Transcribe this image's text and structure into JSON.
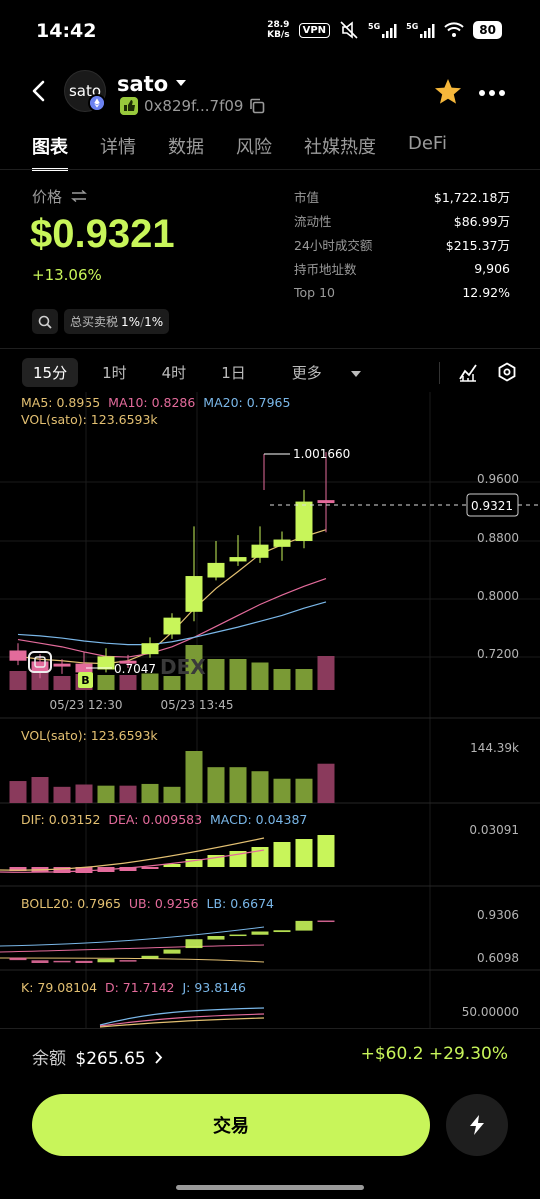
{
  "status": {
    "time": "14:42",
    "speed_top": "28.9",
    "speed_bottom": "KB/s",
    "vpn": "VPN",
    "net1": "5G",
    "net2": "5G",
    "battery": "80"
  },
  "header": {
    "avatar_text": "sato",
    "token": "sato",
    "address": "0x829f...7f09"
  },
  "tabs": [
    "图表",
    "详情",
    "数据",
    "风险",
    "社媒热度",
    "DeFi"
  ],
  "price": {
    "label": "价格",
    "value": "$0.9321",
    "change": "+13.06%",
    "tax_label": "总买卖税",
    "tax_buy": "1%",
    "tax_sep": "/",
    "tax_sell": "1%"
  },
  "stats": [
    {
      "k": "市值",
      "v": "$1,722.18万"
    },
    {
      "k": "流动性",
      "v": "$86.99万"
    },
    {
      "k": "24小时成交额",
      "v": "$215.37万"
    },
    {
      "k": "持币地址数",
      "v": "9,906"
    },
    {
      "k": "Top 10",
      "v": "12.92%"
    }
  ],
  "timeframes": [
    "15分",
    "1时",
    "4时",
    "1日",
    "更多"
  ],
  "indicators": {
    "ma5": "MA5: 0.8955",
    "ma10": "MA10: 0.8286",
    "ma20": "MA20: 0.7965",
    "vol": "VOL(sato): 123.6593k",
    "vol2": "VOL(sato): 123.6593k",
    "dif": "DIF: 0.03152",
    "dea": "DEA: 0.009583",
    "macd": "MACD: 0.04387",
    "boll": "BOLL20: 0.7965",
    "ub": "UB: 0.9256",
    "lb": "LB: 0.6674",
    "k": "K: 79.08104",
    "d": "D: 71.7142",
    "j": "J: 93.8146"
  },
  "chart_labels": {
    "high": "1.001660",
    "low": "0.7047",
    "current": "0.9321",
    "watermark": "DEX",
    "price_ticks": [
      "0.9600",
      "0.8800",
      "0.8000",
      "0.7200"
    ],
    "dates": [
      "05/23 12:30",
      "05/23 13:45"
    ],
    "vol_tick": "144.39k",
    "macd_tick": "0.03091",
    "boll_ticks": [
      "0.9306",
      "0.6098"
    ],
    "kdj_tick": "50.00000",
    "buy_marker": "B"
  },
  "footer": {
    "balance_label": "余额",
    "balance": "$265.65",
    "pnl": "+$60.2 +29.30%",
    "trade": "交易"
  },
  "colors": {
    "up": "#c8f55a",
    "down": "#e36b9b",
    "accent": "#c8f55a",
    "star": "#f5b73b"
  },
  "chart_data": {
    "type": "candlestick",
    "interval": "15分",
    "price_ticks": [
      0.96,
      0.88,
      0.8,
      0.72
    ],
    "high_marker": 1.00166,
    "low_marker": 0.7047,
    "current": 0.9321,
    "candles": [
      {
        "o": 0.73,
        "c": 0.716,
        "h": 0.74,
        "l": 0.71,
        "up": false
      },
      {
        "o": 0.715,
        "c": 0.7,
        "h": 0.725,
        "l": 0.692,
        "up": false
      },
      {
        "o": 0.712,
        "c": 0.708,
        "h": 0.718,
        "l": 0.698,
        "up": false
      },
      {
        "o": 0.712,
        "c": 0.7,
        "h": 0.728,
        "l": 0.69,
        "up": false
      },
      {
        "o": 0.704,
        "c": 0.722,
        "h": 0.733,
        "l": 0.7,
        "up": true
      },
      {
        "o": 0.716,
        "c": 0.712,
        "h": 0.724,
        "l": 0.706,
        "up": false
      },
      {
        "o": 0.725,
        "c": 0.74,
        "h": 0.748,
        "l": 0.72,
        "up": true
      },
      {
        "o": 0.752,
        "c": 0.775,
        "h": 0.781,
        "l": 0.746,
        "up": true
      },
      {
        "o": 0.783,
        "c": 0.832,
        "h": 0.9,
        "l": 0.77,
        "up": true
      },
      {
        "o": 0.83,
        "c": 0.85,
        "h": 0.88,
        "l": 0.826,
        "up": true
      },
      {
        "o": 0.852,
        "c": 0.858,
        "h": 0.888,
        "l": 0.846,
        "up": true
      },
      {
        "o": 0.857,
        "c": 0.875,
        "h": 0.9,
        "l": 0.85,
        "up": true
      },
      {
        "o": 0.872,
        "c": 0.882,
        "h": 0.893,
        "l": 0.853,
        "up": true
      },
      {
        "o": 0.88,
        "c": 0.934,
        "h": 0.95,
        "l": 0.87,
        "up": true
      },
      {
        "o": 0.936,
        "c": 0.932,
        "h": 1.0017,
        "l": 0.892,
        "up": false
      }
    ],
    "ma5": [
      0.722,
      0.718,
      0.716,
      0.713,
      0.712,
      0.716,
      0.728,
      0.755,
      0.787,
      0.815,
      0.838,
      0.862,
      0.875,
      0.886,
      0.8955
    ],
    "ma10": [
      0.745,
      0.74,
      0.735,
      0.728,
      0.722,
      0.721,
      0.726,
      0.735,
      0.748,
      0.763,
      0.778,
      0.793,
      0.806,
      0.818,
      0.8286
    ],
    "ma20": [
      0.752,
      0.75,
      0.747,
      0.743,
      0.74,
      0.738,
      0.738,
      0.742,
      0.748,
      0.755,
      0.762,
      0.77,
      0.778,
      0.788,
      0.7965
    ],
    "volume": [
      38,
      45,
      28,
      32,
      30,
      30,
      33,
      28,
      90,
      62,
      62,
      55,
      42,
      42,
      68
    ],
    "macd_hist": [
      -0.004,
      -0.005,
      -0.006,
      -0.006,
      -0.005,
      -0.004,
      -0.002,
      0.003,
      0.008,
      0.012,
      0.016,
      0.02,
      0.025,
      0.028,
      0.032
    ]
  }
}
